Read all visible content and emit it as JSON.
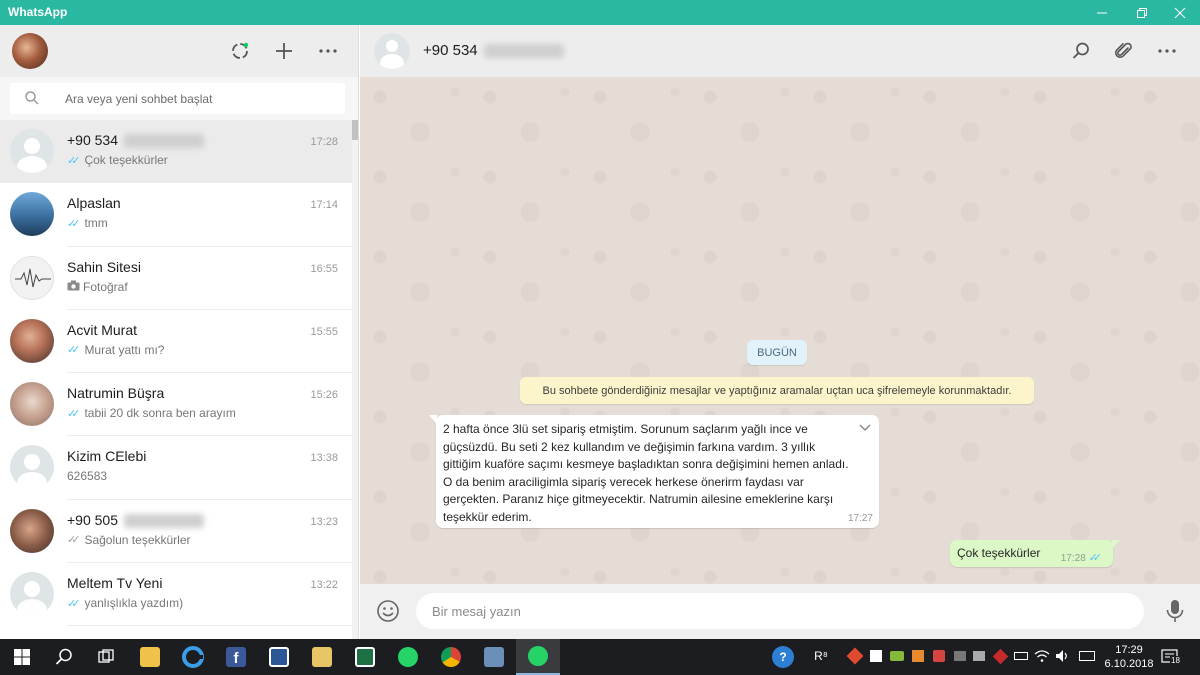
{
  "window": {
    "title": "WhatsApp",
    "accent_color": "#2bb8a2"
  },
  "sidebar": {
    "header_icons": [
      "status-icon",
      "new-chat-icon",
      "menu-icon"
    ],
    "search": {
      "placeholder": "Ara veya yeni sohbet başlat"
    },
    "chats": [
      {
        "name": "+90 534",
        "name_blurred": true,
        "time": "17:28",
        "preview": "Çok teşekkürler",
        "tick": "blue",
        "active": true,
        "avatar": "default"
      },
      {
        "name": "Alpaslan",
        "time": "17:14",
        "preview": "tmm",
        "tick": "blue",
        "avatar": "a-alpaslan"
      },
      {
        "name": "Sahin Sitesi",
        "time": "16:55",
        "preview": "Fotoğraf",
        "tick": "camera",
        "avatar": "a-sahin"
      },
      {
        "name": "Acvit Murat",
        "time": "15:55",
        "preview": "Murat yattı mı?",
        "tick": "blue",
        "avatar": "a-acvit"
      },
      {
        "name": "Natrumin Büşra",
        "time": "15:26",
        "preview": "tabii 20 dk sonra ben arayım",
        "tick": "blue",
        "avatar": "a-busra"
      },
      {
        "name": "Kizim CElebi",
        "time": "13:38",
        "preview": "626583",
        "tick": "none",
        "avatar": "default"
      },
      {
        "name": "+90 505",
        "name_blurred": true,
        "time": "13:23",
        "preview": "Sağolun teşekkürler",
        "tick": "grey",
        "avatar": "a-905"
      },
      {
        "name": "Meltem Tv Yeni",
        "time": "13:22",
        "preview": "yanlışlıkla yazdım)",
        "tick": "blue",
        "avatar": "default"
      }
    ]
  },
  "conversation": {
    "contact_name": "+90 534",
    "header_icons": [
      "search-icon",
      "attach-icon",
      "menu-icon"
    ],
    "date_chip": "BUGÜN",
    "encryption_notice": "Bu sohbete gönderdiğiniz mesajlar ve yaptığınız aramalar uçtan uca şifrelemeyle korunmaktadır.",
    "messages": [
      {
        "direction": "in",
        "text": "2 hafta önce 3lü set sipariş etmiştim. Sorunum saçlarım yağlı ince ve\ngüçsüzdü.  Bu seti 2 kez kullandım ve değişimin farkına vardım. 3 yıllık\ngittiğim kuaföre saçımı kesmeye başladıktan sonra  değişimini hemen anladı.\nO da benim araciligimla sipariş verecek herkese önerirm faydası var\ngerçekten. Paranız hiçe gitmeyecektir. Natrumin ailesine emeklerine karşı\nteşekkür ederim.",
        "time": "17:27"
      },
      {
        "direction": "out",
        "text": "Çok teşekkürler",
        "time": "17:28",
        "status": "read"
      }
    ],
    "compose_placeholder": "Bir mesaj yazın"
  },
  "taskbar": {
    "clock_time": "17:29",
    "clock_date": "6.10.2018",
    "notification_count": "18",
    "tray_label": "R⁸"
  }
}
